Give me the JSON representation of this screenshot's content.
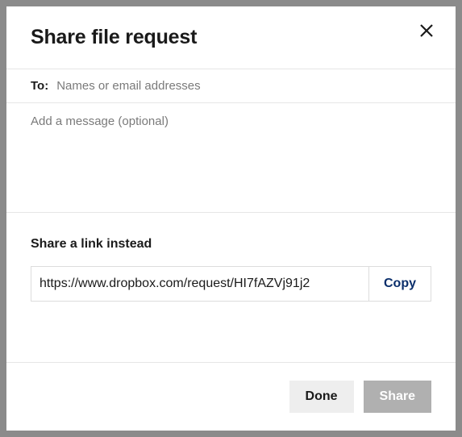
{
  "dialog": {
    "title": "Share file request"
  },
  "to": {
    "label": "To:",
    "placeholder": "Names or email addresses",
    "value": ""
  },
  "message": {
    "placeholder": "Add a message (optional)",
    "value": ""
  },
  "link": {
    "heading": "Share a link instead",
    "url": "https://www.dropbox.com/request/HI7fAZVj91j2",
    "copy_label": "Copy"
  },
  "footer": {
    "done_label": "Done",
    "share_label": "Share"
  }
}
